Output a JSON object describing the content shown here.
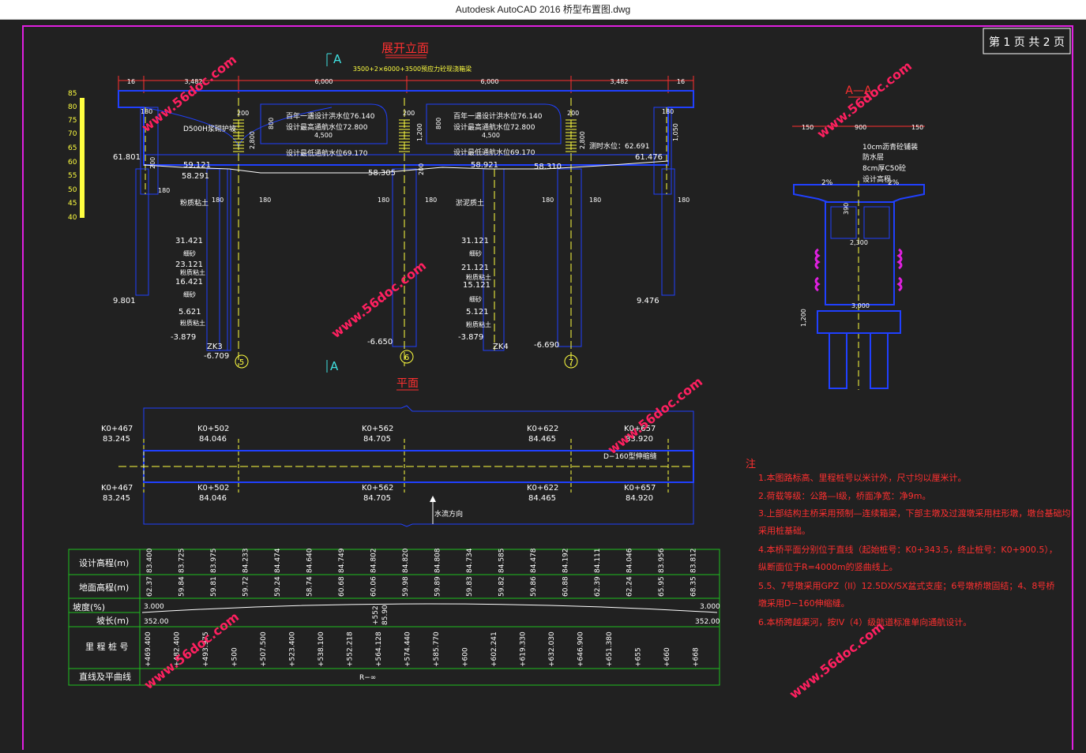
{
  "window": {
    "title": "Autodesk AutoCAD 2016     桥型布置图.dwg"
  },
  "colors": {
    "background": "#212121",
    "frame": "#e020e0",
    "steel": "#2040ff",
    "annotation": "#ffff40",
    "notes": "#ff3030",
    "table": "#20c020",
    "watermark": "#ff2060",
    "white": "#ffffff",
    "cyan": "#40e0e0"
  },
  "page_box": {
    "label": "第 1 页   共 2 页"
  },
  "elevation": {
    "title": "展开立面",
    "section_mark": "A",
    "span_formula": "3500+2×6000+3500预应力砼现浇箱梁",
    "dim_16_left": "16",
    "dim_16_right": "16",
    "span_dims": [
      "3,482",
      "6,000",
      "6,000",
      "3,482"
    ],
    "scale_ticks": [
      "85",
      "80",
      "75",
      "70",
      "65",
      "60",
      "55",
      "50",
      "45",
      "40"
    ],
    "left_abut_top": "61.801",
    "left_abut_bottom": "9.801",
    "right_abut_top": "61.476",
    "right_abut_bottom": "9.476",
    "dim_180": "180",
    "dim_200": "200",
    "dim_800": "800",
    "dim_1200": "1,200",
    "dim_4500": "4,500",
    "dim_2800": "2,800",
    "dim_1050": "1,050",
    "dim_200b": "200",
    "protection": "D500H浆砌护坡",
    "flood_1": "百年一遇设计洪水位76.140",
    "navig_hi_1": "设计最高通航水位72.800",
    "navig_lo_1": "设计最低通航水位69.170",
    "flood_2": "百年一遇设计洪水位76.140",
    "navig_hi_2": "设计最高通航水位72.800",
    "navig_lo_2": "设计最低通航水位69.170",
    "measured_water": "测时水位：62.691",
    "g_59121": "59.121",
    "g_58291": "58.291",
    "g_58305": "58.305",
    "g_58921": "58.921",
    "g_58310": "58.310",
    "soil_1": "粉质粘土",
    "soil_2": "淤泥质土",
    "left_layers": [
      {
        "elev": "31.421",
        "name": "细砂"
      },
      {
        "elev": "23.121",
        "name": "粉质粘土"
      },
      {
        "elev": "16.421",
        "name": "细砂"
      },
      {
        "elev": "5.621",
        "name": "粉质粘土"
      },
      {
        "elev": "-3.879",
        "name": ""
      }
    ],
    "right_layers": [
      {
        "elev": "31.121",
        "name": "细砂"
      },
      {
        "elev": "21.121",
        "name": "粉质粘土"
      },
      {
        "elev": "15.121",
        "name": "细砂"
      },
      {
        "elev": "5.121",
        "name": "粉质粘土"
      },
      {
        "elev": "-3.879",
        "name": ""
      }
    ],
    "zk_left": "ZK3",
    "zk_right": "ZK4",
    "pile_tip_5": "-6.709",
    "pile_tip_6": "-6.650",
    "pile_tip_7": "-6.690",
    "pier_nums": [
      "5",
      "6",
      "7"
    ]
  },
  "section_aa": {
    "title": "A—A",
    "dims_top": [
      "150",
      "900",
      "150"
    ],
    "layers": [
      "10cm沥青砼铺装",
      "防水层",
      "8cm厚C50砼",
      "设计高程"
    ],
    "slope_l": "2%",
    "slope_r": "2%",
    "dim_web": "390",
    "dim_2300": "2,300",
    "dim_3000": "3,000",
    "dim_1200": "1,200"
  },
  "plan": {
    "title": "平面",
    "section_mark": "A",
    "stations_top": [
      {
        "k": "K0+467",
        "v": "83.245"
      },
      {
        "k": "K0+502",
        "v": "84.046"
      },
      {
        "k": "K0+562",
        "v": "84.705"
      },
      {
        "k": "K0+622",
        "v": "84.465"
      },
      {
        "k": "K0+657",
        "v": "83.920"
      }
    ],
    "stations_bottom": [
      {
        "k": "K0+467",
        "v": "83.245"
      },
      {
        "k": "K0+502",
        "v": "84.046"
      },
      {
        "k": "K0+562",
        "v": "84.705"
      },
      {
        "k": "K0+622",
        "v": "84.465"
      },
      {
        "k": "K0+657",
        "v": "84.920"
      }
    ],
    "expansion_joint": "D−160型伸缩缝",
    "flow_direction": "水流方向"
  },
  "table": {
    "row_labels": [
      "设计高程(m)",
      "地面高程(m)",
      "坡度(%)",
      "坡长(m)",
      "里 程 桩 号",
      "直线及平曲线"
    ],
    "design_elev": [
      "83.400",
      "83.725",
      "83.975",
      "84.233",
      "84.474",
      "84.640",
      "84.749",
      "84.802",
      "84.820",
      "84.808",
      "84.734",
      "84.585",
      "84.478",
      "84.192",
      "84.111",
      "84.046",
      "83.956",
      "83.812"
    ],
    "ground_elev": [
      "62.37",
      "59.84",
      "59.81",
      "59.72",
      "59.24",
      "58.74",
      "60.68",
      "60.06",
      "59.98",
      "59.89",
      "59.83",
      "59.82",
      "59.86",
      "60.88",
      "62.39",
      "62.24",
      "65.95",
      "68.35"
    ],
    "grade_left": "3.000",
    "grade_right": "3.000",
    "length_left": "352.00",
    "length_right": "352.00",
    "vpi_station": "+552",
    "vpi_elev": "85.90",
    "stations": [
      "+469.400",
      "+482.400",
      "+493.975",
      "+500",
      "+507.500",
      "+523.400",
      "+538.100",
      "+552.218",
      "+564.128",
      "+574.440",
      "+585.770",
      "+600",
      "+602.241",
      "+619.330",
      "+632.030",
      "+646.900",
      "+651.380",
      "+655",
      "+660",
      "+668"
    ],
    "curve": "R−∞"
  },
  "notes": {
    "title": "注",
    "lines": [
      "1.本图路标高、里程桩号以米计外，尺寸均以厘米计。",
      "2.荷载等级：公路—I级，桥面净宽：净9m。",
      "3.上部结构主桥采用预制—连续箱梁，下部主墩及过渡墩采用柱形墩，墩台基础均",
      "采用桩基础。",
      "4.本桥平面分别位于直线（起始桩号：K0+343.5，终止桩号：K0+900.5），",
      "纵断面位于R=4000m的竖曲线上。",
      "5.5、7号墩采用GPZ（II）12.5DX/SX盆式支座；6号墩桥墩固结；4、8号桥",
      "墩采用D−160伸缩缝。",
      "6.本桥跨越渠河，按IV（4）级航道标准单向通航设计。"
    ]
  },
  "watermark": "www.56doc.com"
}
